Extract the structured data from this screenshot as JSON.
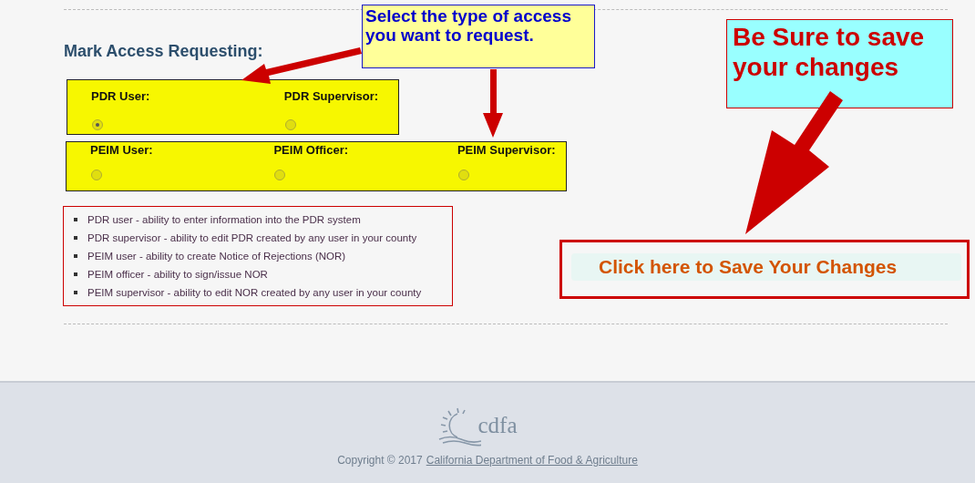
{
  "instruction_callout": "Select the type of access you want to request.",
  "heading": "Mark Access Requesting:",
  "access_groups": [
    {
      "options": [
        {
          "label": "PDR User:",
          "selected": true
        },
        {
          "label": "PDR Supervisor:",
          "selected": false
        }
      ]
    },
    {
      "options": [
        {
          "label": "PEIM User:",
          "selected": false
        },
        {
          "label": "PEIM Officer:",
          "selected": false
        },
        {
          "label": "PEIM Supervisor:",
          "selected": false
        }
      ]
    }
  ],
  "descriptions": [
    "PDR user - ability to enter information into the PDR system",
    "PDR supervisor - ability to edit PDR created by any user in your county",
    "PEIM user - ability to create Notice of Rejections (NOR)",
    "PEIM officer - ability to sign/issue NOR",
    "PEIM supervisor - ability to edit NOR created by any user in your county"
  ],
  "reminder_callout": "Be Sure to save your changes",
  "save_button": "Click here to Save Your Changes",
  "footer": {
    "logo": "cdfa",
    "copyright": "Copyright © 2017",
    "link": "California Department of Food & Agriculture"
  }
}
